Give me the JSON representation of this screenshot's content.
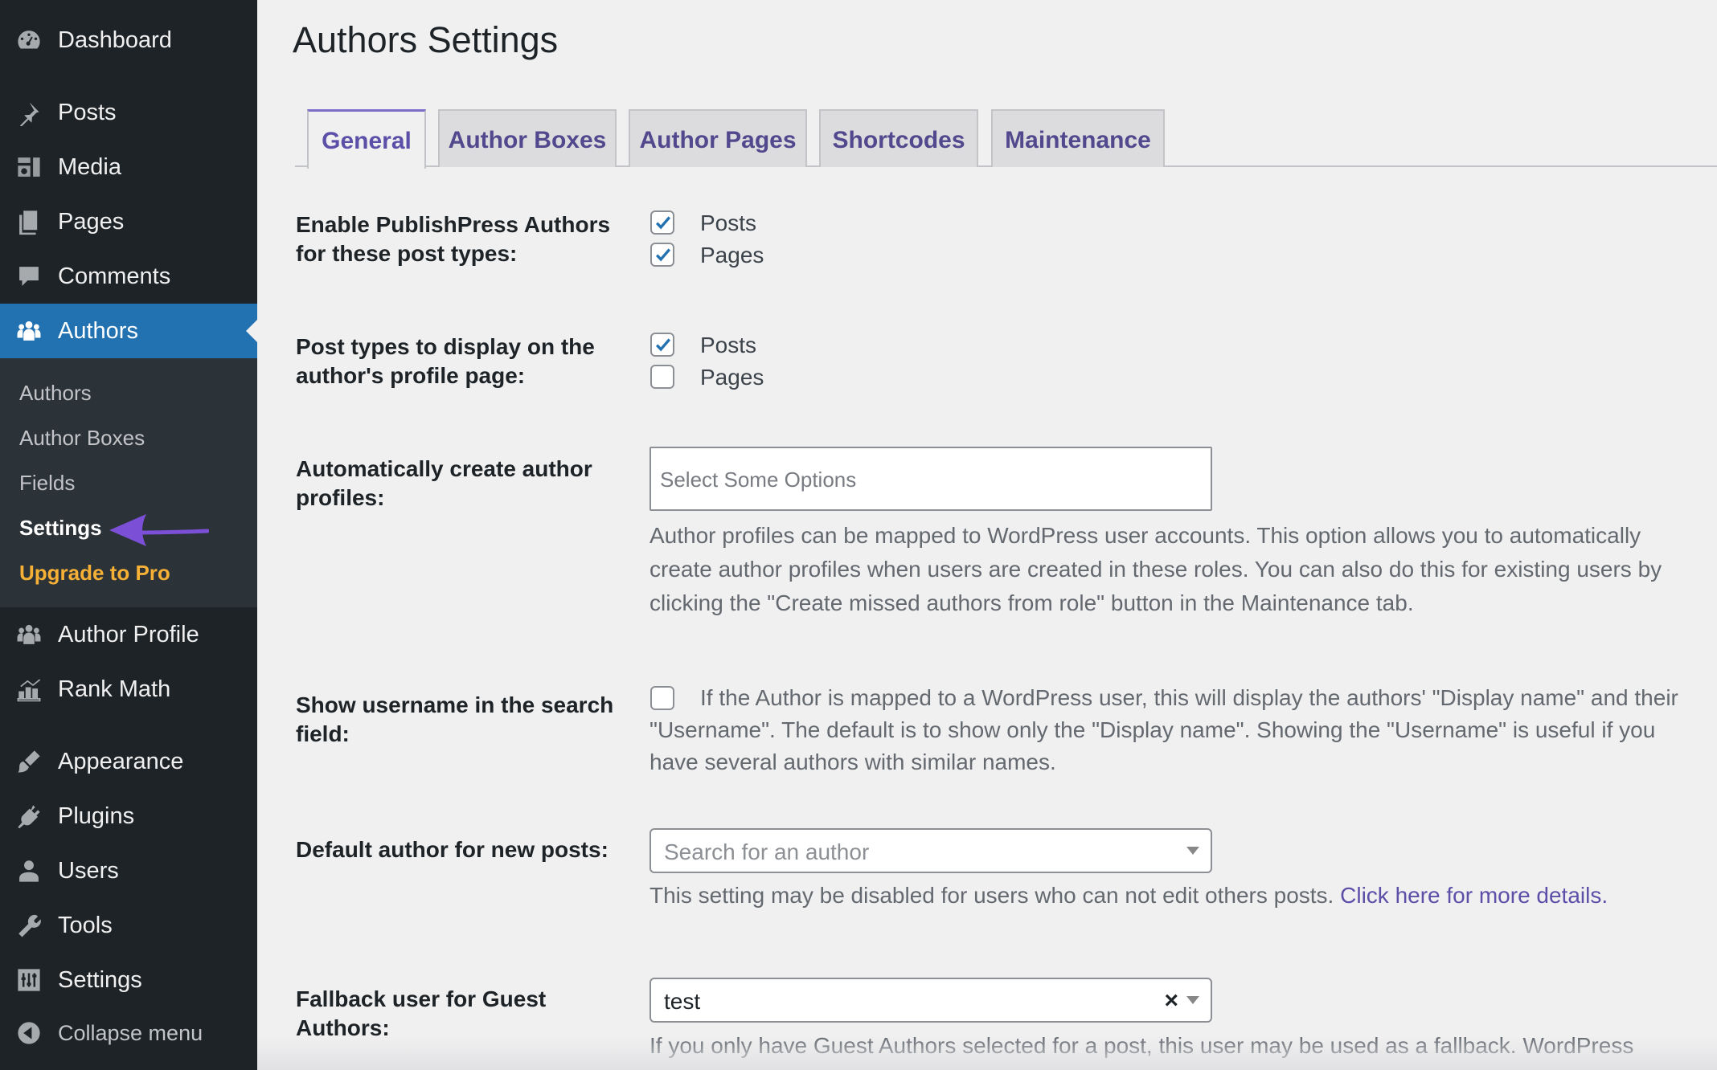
{
  "sidebar": {
    "items": [
      {
        "label": "Dashboard",
        "icon": "dashboard-icon"
      },
      {
        "label": "Posts",
        "icon": "pin-icon"
      },
      {
        "label": "Media",
        "icon": "media-icon"
      },
      {
        "label": "Pages",
        "icon": "pages-icon"
      },
      {
        "label": "Comments",
        "icon": "comment-icon"
      },
      {
        "label": "Authors",
        "icon": "authors-icon",
        "active": true
      },
      {
        "label": "Author Profile",
        "icon": "author-profile-icon"
      },
      {
        "label": "Rank Math",
        "icon": "rank-math-icon"
      },
      {
        "label": "Appearance",
        "icon": "brush-icon"
      },
      {
        "label": "Plugins",
        "icon": "plug-icon"
      },
      {
        "label": "Users",
        "icon": "user-icon"
      },
      {
        "label": "Tools",
        "icon": "wrench-icon"
      },
      {
        "label": "Settings",
        "icon": "settings-icon"
      }
    ],
    "submenu": [
      "Authors",
      "Author Boxes",
      "Fields",
      "Settings",
      "Upgrade to Pro"
    ],
    "collapse_label": "Collapse menu"
  },
  "page": {
    "title": "Authors Settings"
  },
  "tabs": [
    "General",
    "Author Boxes",
    "Author Pages",
    "Shortcodes",
    "Maintenance"
  ],
  "settings": {
    "post_types": {
      "label_line1": "Enable PublishPress Authors",
      "label_line2": "for these post types:",
      "options": [
        {
          "label": "Posts",
          "checked": true
        },
        {
          "label": "Pages",
          "checked": true
        }
      ]
    },
    "profile_page": {
      "label_line1": "Post types to display on the",
      "label_line2": "author's profile page:",
      "options": [
        {
          "label": "Posts",
          "checked": true
        },
        {
          "label": "Pages",
          "checked": false
        }
      ]
    },
    "auto_create": {
      "label_line1": "Automatically create author",
      "label_line2": "profiles:",
      "placeholder": "Select Some Options",
      "desc_line1": "Author profiles can be mapped to WordPress user accounts. This option allows you to automatically",
      "desc_line2": "create author profiles when users are created in these roles. You can also do this for existing users by",
      "desc_line3": "clicking the \"Create missed authors from role\" button in the Maintenance tab."
    },
    "show_username": {
      "label_line1": "Show username in the search",
      "label_line2": "field:",
      "checked": false,
      "desc_line1": "If the Author is mapped to a WordPress user, this will display the authors' \"Display name\" and their",
      "desc_line2": "\"Username\". The default is to show only the \"Display name\". Showing the \"Username\" is useful if you",
      "desc_line3": "have several authors with similar names."
    },
    "default_author": {
      "label": "Default author for new posts:",
      "placeholder": "Search for an author",
      "desc": "This setting may be disabled for users who can not edit others posts.",
      "link": "Click here for more details."
    },
    "fallback_user": {
      "label_line1": "Fallback user for Guest",
      "label_line2": "Authors:",
      "value": "test",
      "clear": "×",
      "desc": "If you only have Guest Authors selected for a post, this user may be used as a fallback. WordPress"
    }
  },
  "colors": {
    "sidebar_bg": "#1d2327",
    "active": "#2271b1",
    "accent": "#5b4fa8",
    "arrow": "#7b4fd6",
    "pro": "#f6b036"
  }
}
